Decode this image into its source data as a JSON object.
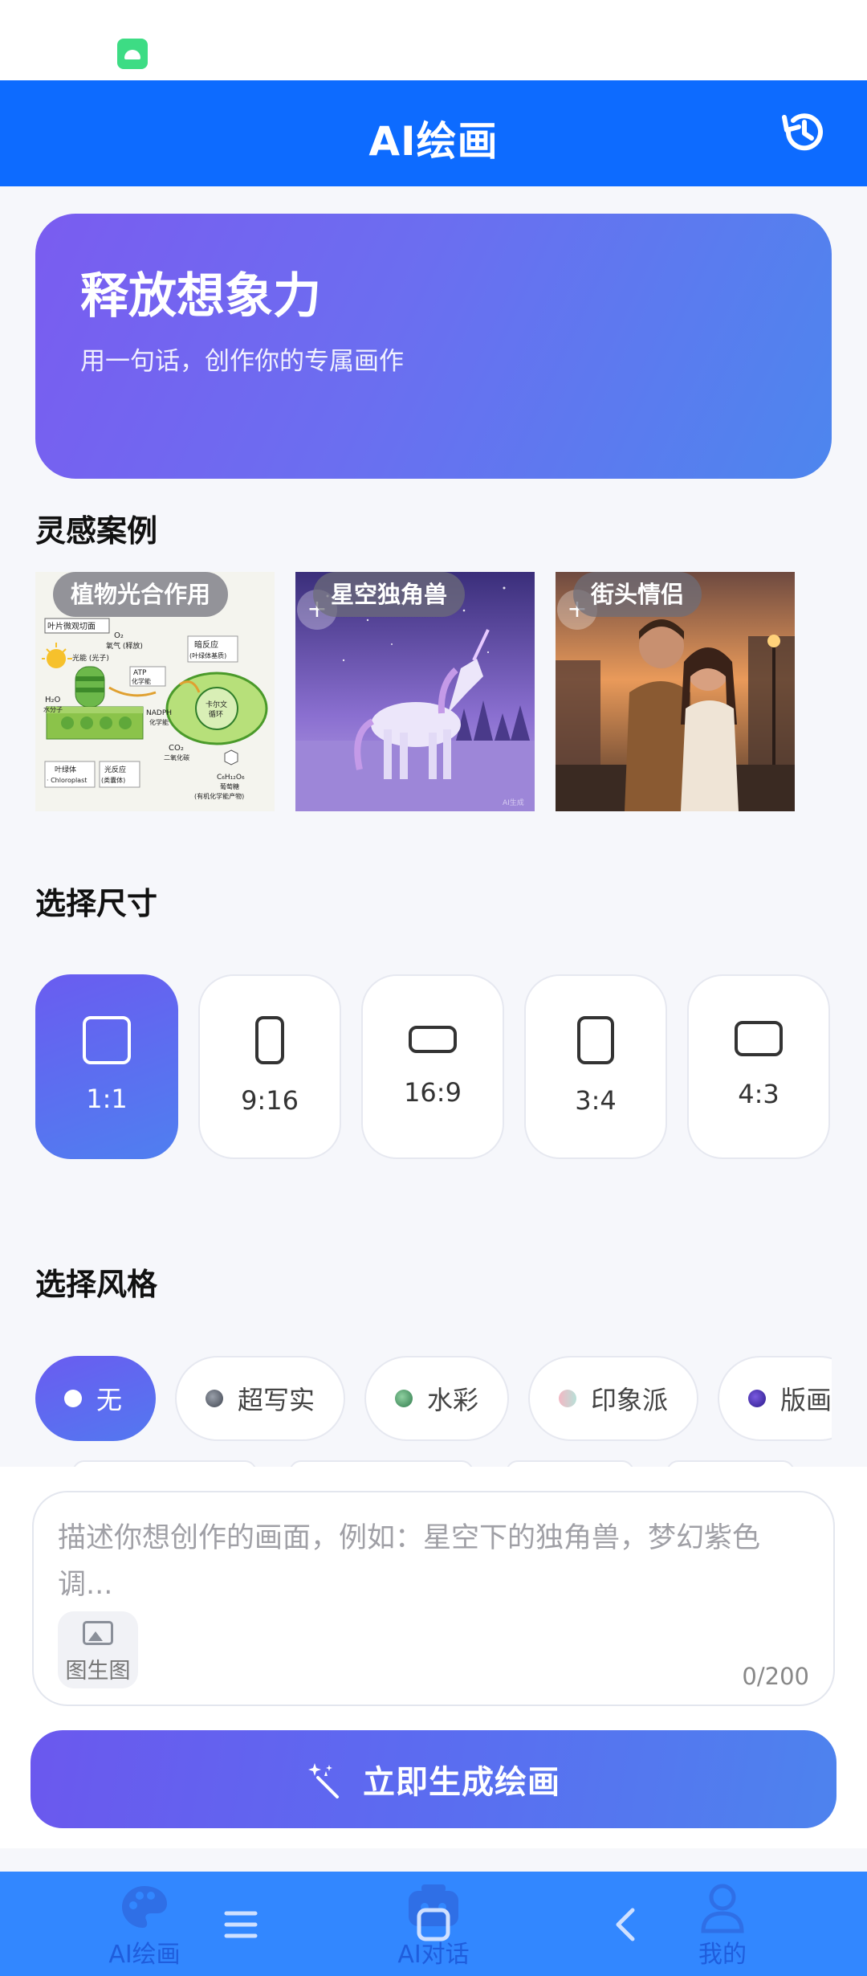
{
  "app_bar": {
    "title": "AI绘画",
    "history_icon": "history-icon"
  },
  "hero": {
    "headline": "释放想象力",
    "subtitle": "用一句话，创作你的专属画作"
  },
  "inspiration": {
    "title": "灵感案例",
    "cases": [
      {
        "label": "植物光合作用",
        "image": "photosynthesis-diagram"
      },
      {
        "label": "星空独角兽",
        "image": "unicorn-starry-sky"
      },
      {
        "label": "街头情侣",
        "image": "street-couple-sunset"
      }
    ],
    "diagram_labels": {
      "leaf": "叶片微观切面",
      "o2": "O₂",
      "o2_note": "氧气 (释放)",
      "light": "光能 (光子)",
      "atp": "ATP",
      "atp_note": "化学能",
      "h2o": "H₂O",
      "h2o_note": "水分子",
      "nadph": "NADPH",
      "nadph_note": "化学能",
      "dark": "暗反应",
      "dark_note": "(叶绿体基质)",
      "calvin": "卡尔文",
      "calvin2": "循环",
      "co2": "CO₂",
      "co2_note": "二氧化碳",
      "glucose": "C₆H₁₂O₆",
      "glucose_note": "葡萄糖",
      "glucose_note2": "(有机化学能产物)",
      "chloro": "叶绿体",
      "chloro_en": "· Chloroplast",
      "lightrx": "光反应",
      "lightrx_note": "(类囊体)"
    },
    "watermark": "AI生成"
  },
  "size": {
    "title": "选择尺寸",
    "selected": "1:1",
    "options": [
      {
        "label": "1:1"
      },
      {
        "label": "9:16"
      },
      {
        "label": "16:9"
      },
      {
        "label": "3:4"
      },
      {
        "label": "4:3"
      }
    ]
  },
  "style": {
    "title": "选择风格",
    "selected": "无",
    "options": [
      {
        "label": "无",
        "dot": "#ffffff"
      },
      {
        "label": "超写实",
        "dot": "#5a6270"
      },
      {
        "label": "水彩",
        "dot": "#3c8a5c"
      },
      {
        "label": "印象派",
        "dot": "#e8c4cc"
      },
      {
        "label": "版画",
        "dot": "#4a2fb0"
      }
    ]
  },
  "prompt": {
    "placeholder": "描述你想创作的画面，例如：星空下的独角兽，梦幻紫色调...",
    "image_to_image": "图生图",
    "counter": "0/200"
  },
  "generate_button": "立即生成绘画",
  "tab_bar": {
    "tabs": [
      {
        "label": "AI绘画"
      },
      {
        "label": "AI对话"
      },
      {
        "label": "我的"
      }
    ]
  },
  "colors": {
    "primary": "#0d6bff",
    "accent_start": "#6b58ee",
    "accent_end": "#4d83ee",
    "tab_bar": "#3287ff"
  }
}
